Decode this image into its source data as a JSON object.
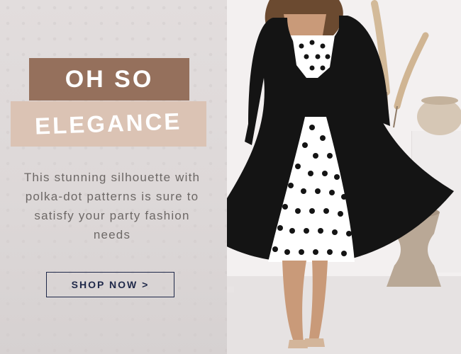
{
  "banner": {
    "headline_line1": "OH SO",
    "headline_line2": "ELEGANCE",
    "description": "This stunning silhouette with polka-dot patterns  is sure to satisfy your party fashion needs",
    "cta_label": "SHOP NOW",
    "cta_icon": "chevron-right-icon"
  },
  "colors": {
    "headline_bg_dark": "#95705c",
    "headline_bg_light": "#dbc3b4",
    "cta_border": "#1f2849",
    "desc_text": "#6d6866"
  }
}
